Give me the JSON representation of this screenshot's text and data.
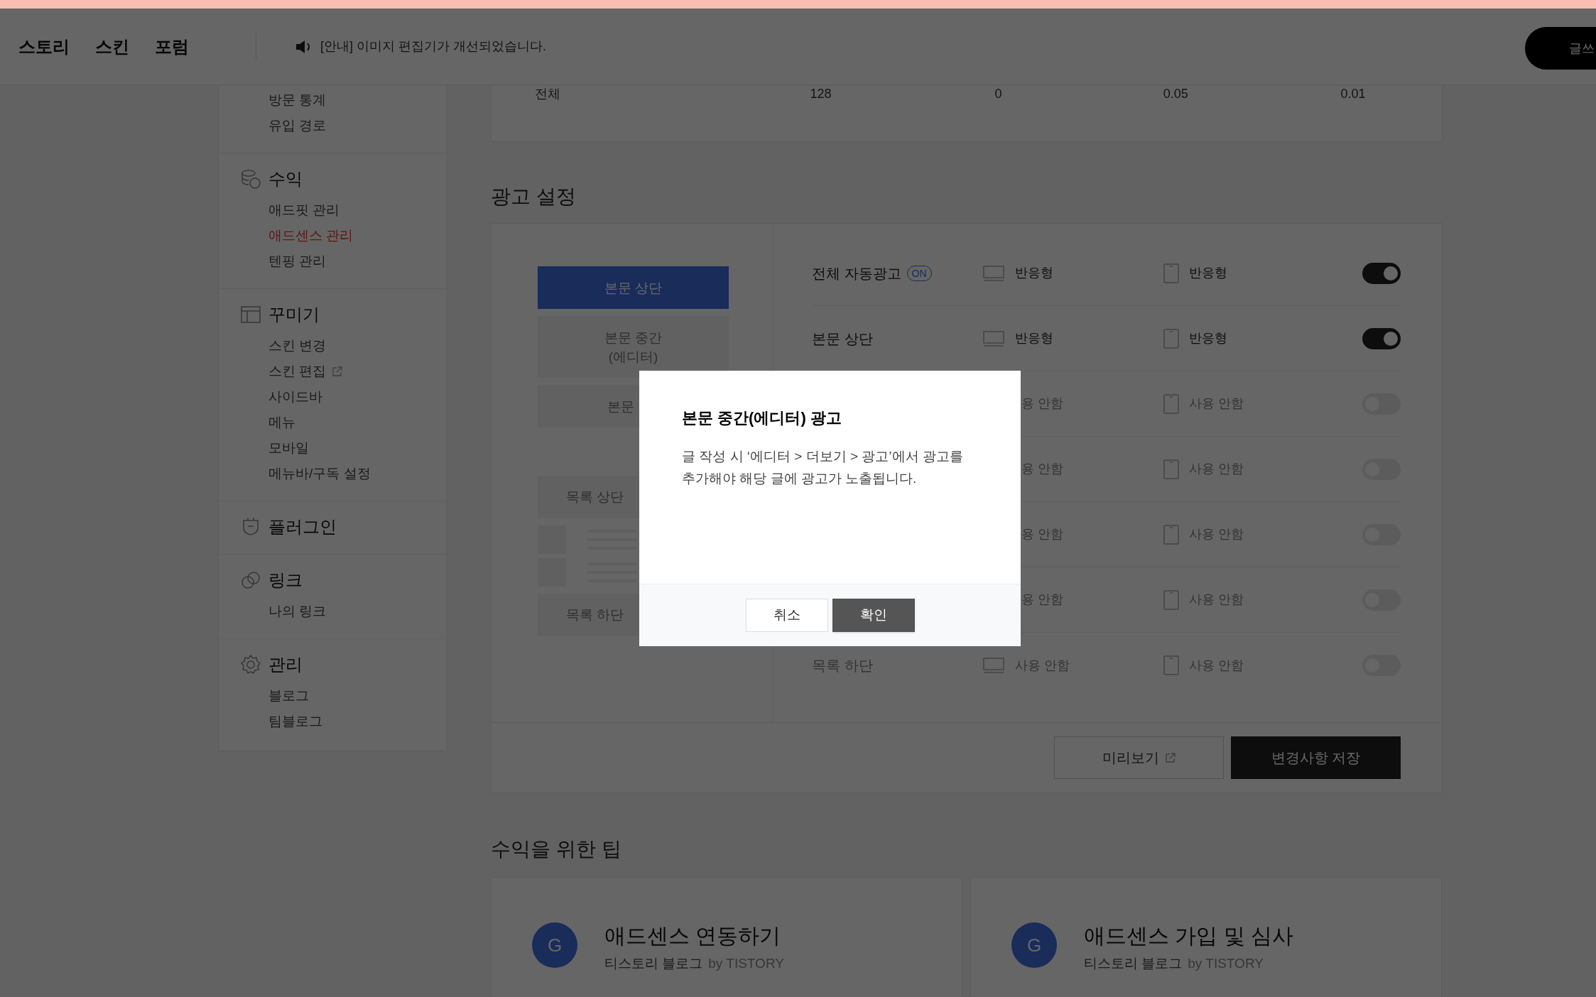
{
  "top_nav": {
    "items": [
      {
        "label": "스토리"
      },
      {
        "label": "스킨"
      },
      {
        "label": "포럼"
      }
    ],
    "notice": "[안내] 이미지 편집기가 개선되었습니다.",
    "write_button": "글쓰"
  },
  "sidebar": {
    "groups": [
      {
        "items": [
          {
            "label": "방문 통계",
            "selected": false
          },
          {
            "label": "유입 경로",
            "selected": false
          }
        ]
      },
      {
        "title": "수익",
        "items": [
          {
            "label": "애드핏 관리",
            "selected": false
          },
          {
            "label": "애드센스 관리",
            "selected": true
          },
          {
            "label": "텐핑 관리",
            "selected": false
          }
        ]
      },
      {
        "title": "꾸미기",
        "items": [
          {
            "label": "스킨 변경",
            "selected": false
          },
          {
            "label": "스킨 편집",
            "selected": false,
            "external": true
          },
          {
            "label": "사이드바",
            "selected": false
          },
          {
            "label": "메뉴",
            "selected": false
          },
          {
            "label": "모바일",
            "selected": false
          },
          {
            "label": "메뉴바/구독 설정",
            "selected": false
          }
        ]
      },
      {
        "title": "플러그인"
      },
      {
        "title": "링크",
        "items": [
          {
            "label": "나의 링크",
            "selected": false
          }
        ]
      },
      {
        "title": "관리",
        "items": [
          {
            "label": "블로그",
            "selected": false
          },
          {
            "label": "팀블로그",
            "selected": false
          }
        ]
      }
    ]
  },
  "stats_row": {
    "label": "전체",
    "values": [
      "128",
      "0",
      "0.05",
      "0.01"
    ]
  },
  "ad_settings": {
    "title": "광고 설정",
    "positions": [
      {
        "label": "본문 상단",
        "selected": true
      },
      {
        "label": "본문 중간\n(에디터)",
        "selected": false
      },
      {
        "label": "본문",
        "selected": false
      },
      {
        "label": "목록 상단",
        "selected": false,
        "kind": "list"
      },
      {
        "label": "목록 하단",
        "selected": false,
        "kind": "list"
      }
    ],
    "rows": [
      {
        "label": "전체 자동광고",
        "badge": "ON",
        "desktop": "반응형",
        "mobile": "반응형",
        "on": true
      },
      {
        "label": "본문 상단",
        "desktop": "반응형",
        "mobile": "반응형",
        "on": true
      },
      {
        "desktop": "용 안함",
        "mobile": "사용 안함",
        "on": false
      },
      {
        "desktop": "용 안함",
        "mobile": "사용 안함",
        "on": false
      },
      {
        "desktop": "용 안함",
        "mobile": "사용 안함",
        "on": false
      },
      {
        "desktop": "용 안함",
        "mobile": "사용 안함",
        "on": false
      },
      {
        "label": "목록 하단",
        "desktop": "사용 안함",
        "mobile": "사용 안함",
        "on": false
      }
    ],
    "preview_button": "미리보기",
    "save_button": "변경사항 저장"
  },
  "tips": {
    "title": "수익을 위한 팁",
    "cards": [
      {
        "avatar": "G",
        "title": "애드센스 연동하기",
        "source": "티스토리 블로그",
        "by": "by TISTORY"
      },
      {
        "avatar": "G",
        "title": "애드센스 가입 및 심사",
        "source": "티스토리 블로그",
        "by": "by TISTORY"
      }
    ]
  },
  "modal": {
    "title": "본문 중간(에디터) 광고",
    "body": "글 작성 시 ‘에디터 > 더보기 > 광고’에서 광고를 추가해야 해당 글에 광고가 노출됩니다.",
    "cancel": "취소",
    "ok": "확인"
  }
}
